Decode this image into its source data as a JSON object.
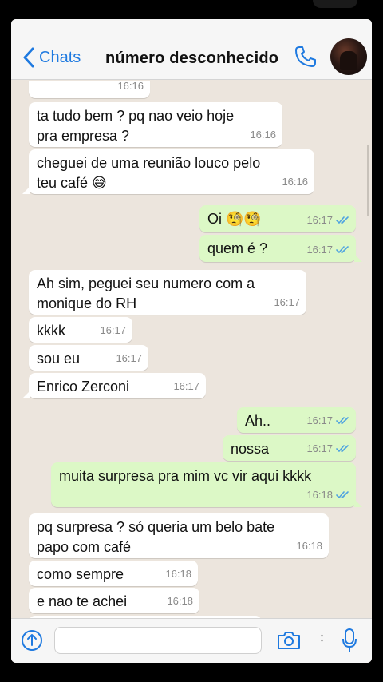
{
  "header": {
    "back_label": "Chats",
    "contact_name": "número desconhecido",
    "call_icon": "phone-icon",
    "avatar": "contact-avatar-photo",
    "accent_color": "#1f7ae0"
  },
  "colors": {
    "chat_background": "#ece5dd",
    "incoming_bubble": "#ffffff",
    "outgoing_bubble": "#dcf8c6",
    "read_ticks": "#4fa3e0"
  },
  "messages": [
    {
      "dir": "in",
      "text": "",
      "time": "16:16"
    },
    {
      "dir": "in",
      "text": "ta tudo bem ? pq nao veio hoje\npra empresa ?",
      "time": "16:16"
    },
    {
      "dir": "in",
      "text": "cheguei de uma reunião louco pelo\nteu café 😅",
      "time": "16:16"
    },
    {
      "dir": "out",
      "text": "Oi 🧐🧐",
      "time": "16:17",
      "status": "read"
    },
    {
      "dir": "out",
      "text": "quem é ?",
      "time": "16:17",
      "status": "read"
    },
    {
      "dir": "in",
      "text": "Ah sim, peguei seu numero com a\nmonique do RH",
      "time": "16:17"
    },
    {
      "dir": "in",
      "text": "kkkk",
      "time": "16:17"
    },
    {
      "dir": "in",
      "text": "sou eu",
      "time": "16:17"
    },
    {
      "dir": "in",
      "text": "Enrico Zerconi",
      "time": "16:17"
    },
    {
      "dir": "out",
      "text": "Ah..",
      "time": "16:17",
      "status": "read"
    },
    {
      "dir": "out",
      "text": "nossa",
      "time": "16:17",
      "status": "read"
    },
    {
      "dir": "out",
      "text": "muita surpresa pra mim vc vir aqui kkkk",
      "time": "16:18",
      "status": "read"
    },
    {
      "dir": "in",
      "text": "pq surpresa ? só queria um belo bate\npapo com café",
      "time": "16:18"
    },
    {
      "dir": "in",
      "text": "como sempre",
      "time": "16:18"
    },
    {
      "dir": "in",
      "text": "e nao te achei",
      "time": "16:18"
    },
    {
      "dir": "in",
      "text": "",
      "time": ""
    }
  ],
  "input_bar": {
    "message_value": "",
    "plus_icon": "arrow-up-circle-icon",
    "camera_icon": "camera-icon",
    "mic_icon": "microphone-icon"
  }
}
